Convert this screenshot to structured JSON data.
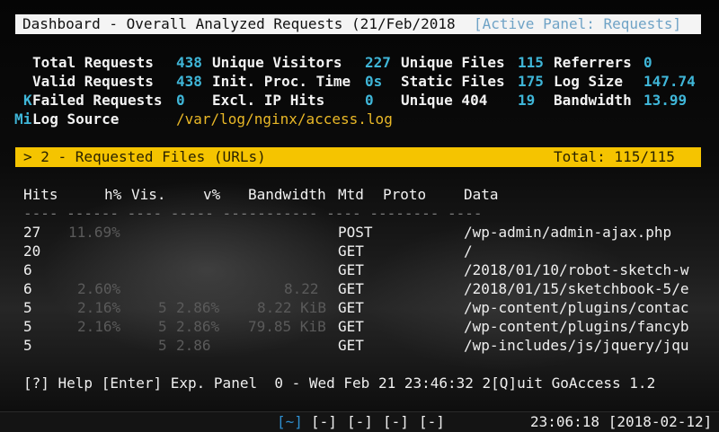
{
  "title": {
    "text": "Dashboard - Overall Analyzed Requests (21/Feb/2018",
    "active_panel": "[Active Panel: Requests]"
  },
  "overall": {
    "total_requests_label": "Total Requests",
    "total_requests": "438",
    "unique_visitors_label": "Unique Visitors",
    "unique_visitors": "227",
    "unique_files_label": "Unique Files",
    "unique_files": "115",
    "referrers_label": "Referrers",
    "referrers": "0",
    "valid_requests_label": "Valid Requests",
    "valid_requests": "438",
    "init_proc_label": "Init. Proc. Time",
    "init_proc": "0s",
    "static_files_label": "Static Files",
    "static_files": "175",
    "log_size_label": "Log Size",
    "log_size": "147.74",
    "log_size_unit": "K",
    "failed_requests_label": "Failed Requests",
    "failed_requests": "0",
    "excl_ip_label": "Excl. IP Hits",
    "excl_ip": "0",
    "unique404_label": "Unique 404",
    "unique404": "19",
    "bandwidth_label": "Bandwidth",
    "bandwidth": "13.99",
    "bandwidth_unit": "Mi",
    "log_source_label": "Log Source",
    "log_source": "/var/log/nginx/access.log"
  },
  "panel": {
    "title": "> 2 - Requested Files (URLs)",
    "total": "Total: 115/115"
  },
  "table": {
    "headers": [
      "Hits",
      "h%",
      "Vis.",
      "v%",
      "Bandwidth",
      "Mtd",
      "Proto",
      "Data"
    ],
    "separator": "---- ------ ---- ----- ----------- ---- -------- ----",
    "rows": [
      {
        "hits": "27",
        "hp": "11.69%",
        "vis": "",
        "vp": "",
        "bw": "",
        "mtd": "POST",
        "proto": "",
        "data": "/wp-admin/admin-ajax.php"
      },
      {
        "hits": "20",
        "hp": "",
        "vis": "",
        "vp": "",
        "bw": "",
        "mtd": "GET",
        "proto": "",
        "data": "/"
      },
      {
        "hits": "6",
        "hp": "",
        "vis": "",
        "vp": "",
        "bw": "",
        "mtd": "GET",
        "proto": "",
        "data": "/2018/01/10/robot-sketch-w"
      },
      {
        "hits": "6",
        "hp": "2.60%",
        "vis": "",
        "vp": "",
        "bw": "8.22",
        "mtd": "GET",
        "proto": "",
        "data": "/2018/01/15/sketchbook-5/e"
      },
      {
        "hits": "5",
        "hp": "2.16%",
        "vis": "5",
        "vp": "2.86%",
        "bw": "8.22 KiB",
        "mtd": "GET",
        "proto": "",
        "data": "/wp-content/plugins/contac"
      },
      {
        "hits": "5",
        "hp": "2.16%",
        "vis": "5",
        "vp": "2.86%",
        "bw": "79.85 KiB",
        "mtd": "GET",
        "proto": "",
        "data": "/wp-content/plugins/fancyb"
      },
      {
        "hits": "5",
        "hp": "",
        "vis": "5",
        "vp": "2.86",
        "bw": "",
        "mtd": "GET",
        "proto": "",
        "data": "/wp-includes/js/jquery/jqu"
      }
    ]
  },
  "footer": {
    "text": "[?] Help [Enter] Exp. Panel  0 - Wed Feb 21 23:46:32 2[Q]uit GoAccess 1.2"
  },
  "statusbar": {
    "active_tab": "[~]",
    "tabs": [
      "[-]",
      "[-]",
      "[-]",
      "[-]"
    ],
    "clock": "23:06:18 [2018-02-12]"
  }
}
